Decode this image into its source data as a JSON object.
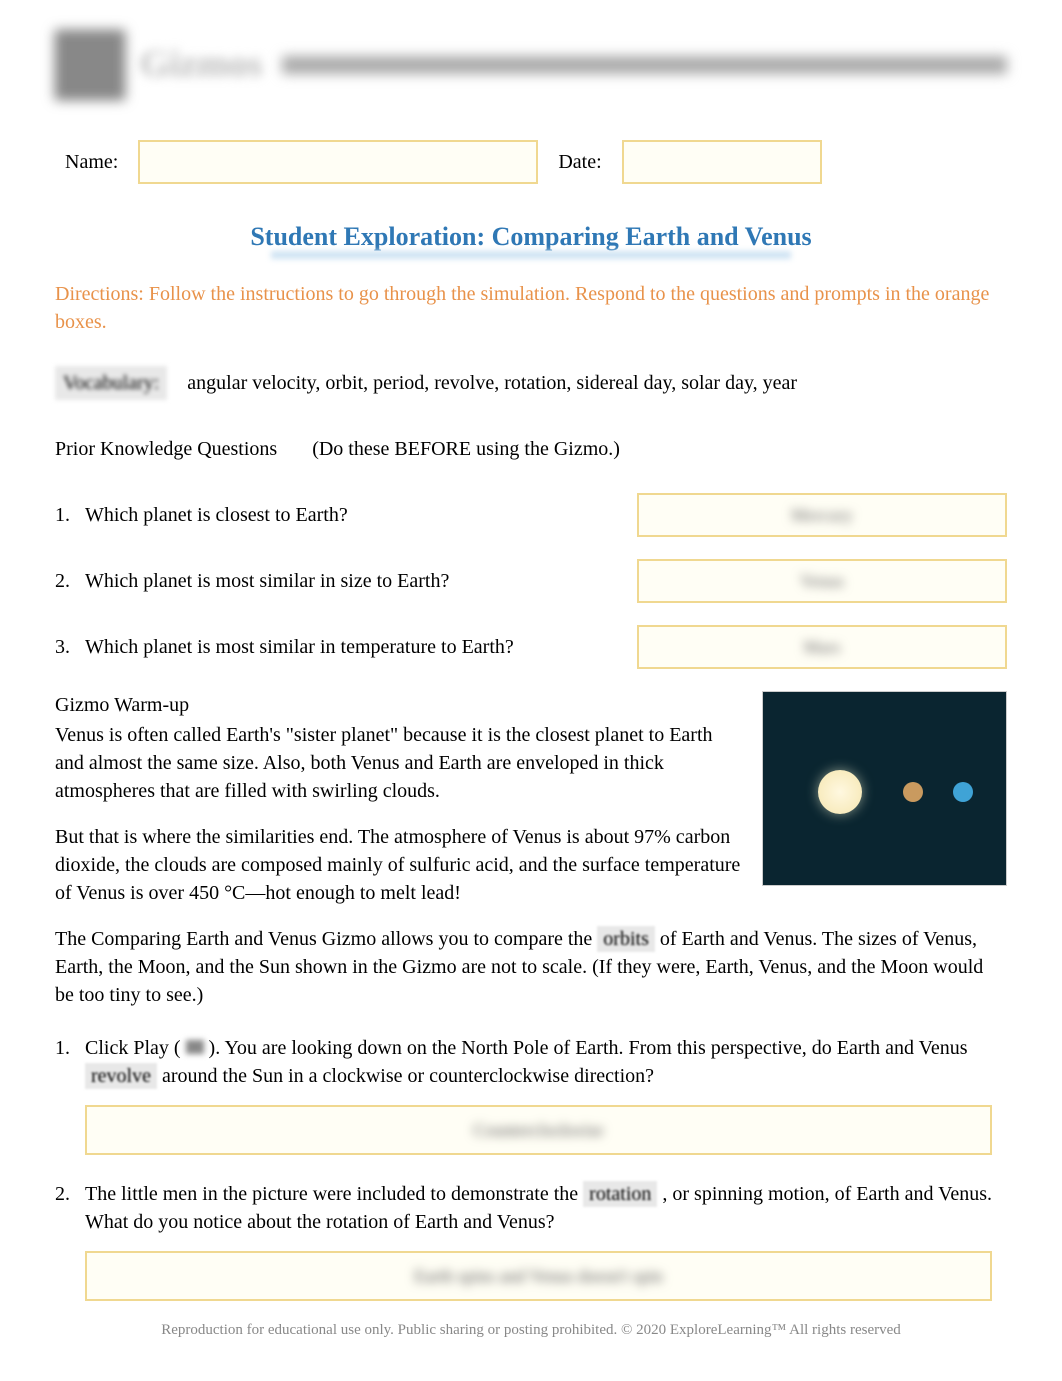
{
  "header": {
    "logo_text": "Gizmos"
  },
  "name_date": {
    "name_label": "Name:",
    "date_label": "Date:",
    "name_value": "",
    "date_value": ""
  },
  "title": "Student Exploration: Comparing Earth and Venus",
  "directions": "Directions: Follow the instructions to go through the simulation. Respond to the questions and prompts in the orange boxes.",
  "vocabulary": {
    "label": "Vocabulary:",
    "terms": "angular velocity, orbit, period, revolve, rotation, sidereal day, solar day, year"
  },
  "prior_knowledge": {
    "heading": "Prior Knowledge Questions",
    "note": "(Do these BEFORE using the Gizmo.)"
  },
  "questions": [
    {
      "num": "1.",
      "text": "Which planet is closest to Earth?",
      "answer": "Mercury"
    },
    {
      "num": "2.",
      "text": "Which planet is most similar in size to Earth?",
      "answer": "Venus"
    },
    {
      "num": "3.",
      "text": " Which planet is most similar in temperature to Earth?",
      "answer": "Mars"
    }
  ],
  "warmup": {
    "heading": "Gizmo Warm-up",
    "p1": "Venus is often called Earth's \"sister planet\" because it is the closest planet to Earth and almost the same size. Also, both Venus and Earth are enveloped in thick atmospheres that are filled with swirling clouds.",
    "p2": "But that is where the similarities end. The atmosphere of Venus is about 97% carbon dioxide, the clouds are composed mainly of sulfuric acid, and the surface temperature of Venus is over 450 °C—hot enough to melt lead!",
    "p3_pre": "The ",
    "p3_gizmo": "Comparing Earth and Venus",
    "p3_mid": " Gizmo allows you to compare the ",
    "p3_orbits": "orbits",
    "p3_post": " of Earth and Venus. The sizes of Venus, Earth, the Moon, and the Sun shown in the Gizmo are not to scale. (If they were, Earth, Venus, and the Moon would be too tiny to see.)"
  },
  "warmup_questions": [
    {
      "num": "1.",
      "pre": "Click Play (",
      "post": "). You are looking down on the North Pole of Earth. From this perspective, do Earth and Venus ",
      "keyword": "revolve",
      "post2": " around the Sun in a clockwise or counterclockwise direction?",
      "answer": "Counterclockwise"
    },
    {
      "num": "2.",
      "pre": "The little men in the picture were included to demonstrate the ",
      "keyword": "rotation",
      "post": ", or spinning motion, of Earth and Venus. What do you notice about the rotation of Earth and Venus?",
      "answer": "Earth spins and Venus doesn't spin"
    }
  ],
  "footer": "Reproduction for educational use only. Public sharing or posting prohibited. © 2020 ExploreLearning™ All rights reserved"
}
